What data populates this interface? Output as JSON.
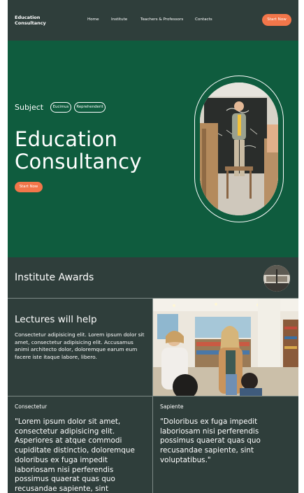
{
  "header": {
    "logo_line1": "Education",
    "logo_line2": "Consultancy",
    "nav": [
      "Home",
      "Institute",
      "Teachers & Professors",
      "Contacts"
    ],
    "cta_label": "Start Now"
  },
  "hero": {
    "subject_label": "Subject",
    "tags": [
      "Eucimus",
      "Reprehenderit"
    ],
    "title_line1": "Education",
    "title_line2": "Consultancy",
    "cta_label": "Start Now"
  },
  "awards": {
    "title": "Institute Awards"
  },
  "lectures": {
    "title": "Lectures will help",
    "body": "Consectetur adipisicing elit. Lorem ipsum dolor sit amet, consectetur adipisicing elit. Accusamus animi architecto dolor, doloremque earum eum facere iste itaque labore, libero."
  },
  "quotes": [
    {
      "label": "Consectetur",
      "text": "\"Lorem ipsum dolor sit amet, consectetur adipisicing elit. Asperiores at atque commodi cupiditate distinctio, doloremque doloribus ex fuga impedit laboriosam nisi perferendis possimus quaerat quas quo recusandae sapiente, sint"
    },
    {
      "label": "Sapiente",
      "text": "\"Doloribus ex fuga impedit laboriosam nisi perferendis possimus quaerat quas quo recusandae sapiente, sint voluptatibus.\""
    }
  ],
  "colors": {
    "dark_slate": "#2f3e3b",
    "forest_green": "#0f5c3e",
    "accent_orange": "#f2764a",
    "divider": "#7d8a86"
  }
}
